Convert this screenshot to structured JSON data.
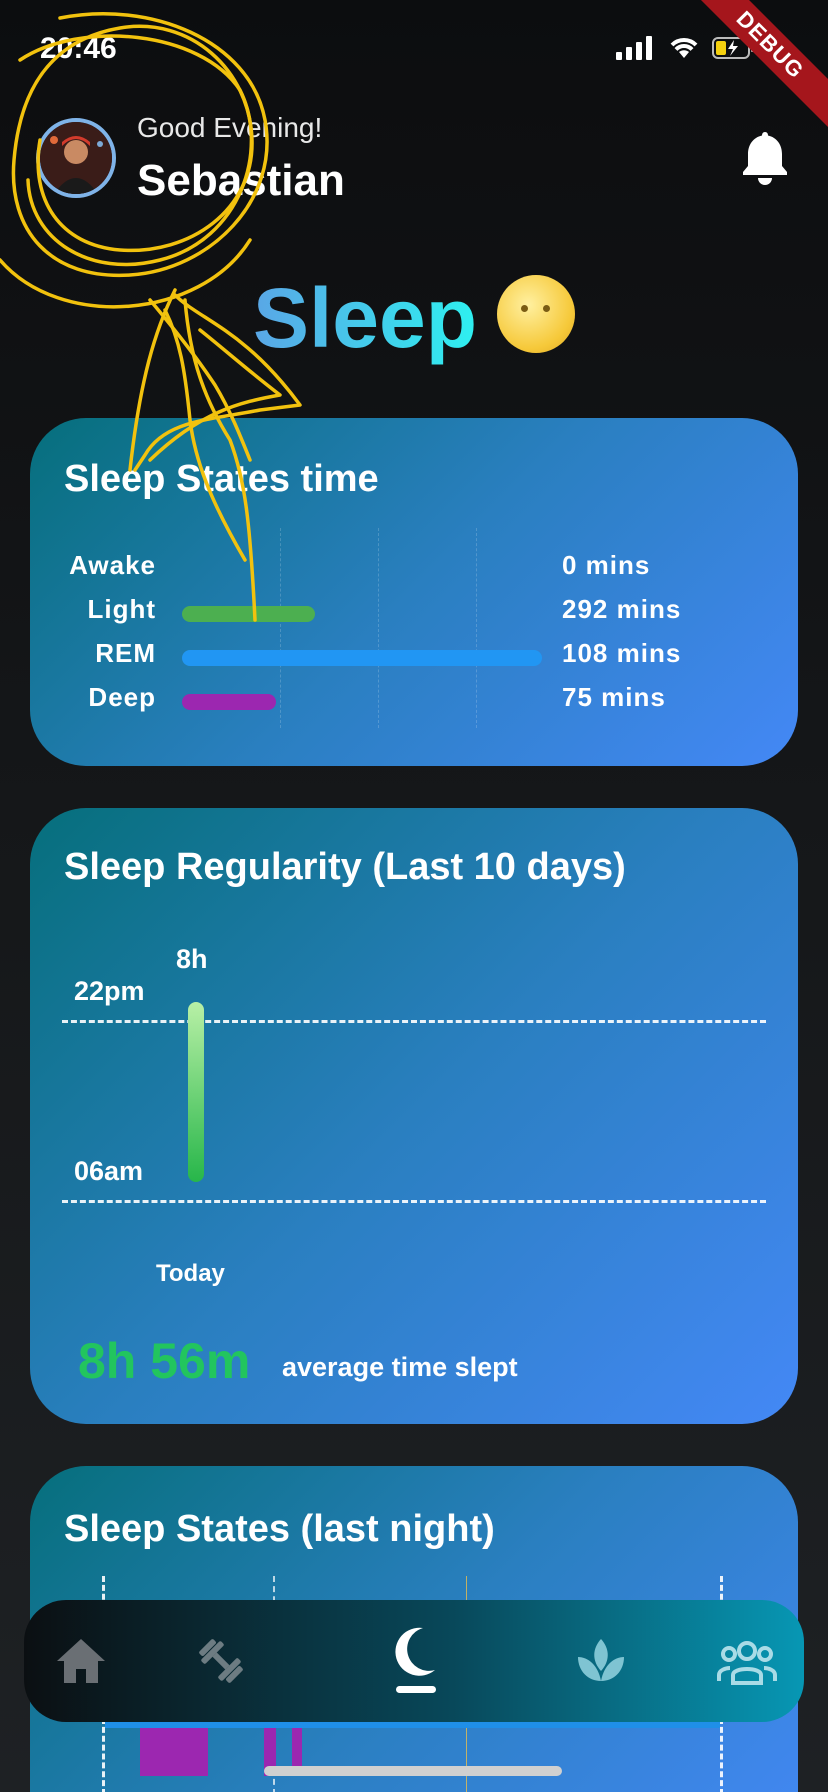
{
  "status_bar": {
    "time": "20:46",
    "debug_label": "DEBUG"
  },
  "header": {
    "greeting": "Good Evening!",
    "user_name": "Sebastian"
  },
  "page": {
    "title": "Sleep"
  },
  "sleep_states_time": {
    "title": "Sleep States time",
    "rows": [
      {
        "label": "Awake",
        "value": "0 mins",
        "bar_fraction": 0.0,
        "color": "#4caf50"
      },
      {
        "label": "Light",
        "value": "292 mins",
        "bar_fraction": 0.37,
        "color": "#4caf50"
      },
      {
        "label": "REM",
        "value": "108 mins",
        "bar_fraction": 1.0,
        "color": "#2196f3"
      },
      {
        "label": "Deep",
        "value": "75 mins",
        "bar_fraction": 0.26,
        "color": "#9c27b0"
      }
    ]
  },
  "sleep_regularity": {
    "title": "Sleep Regularity (Last 10 days)",
    "bar_label": "8h",
    "top_time": "22pm",
    "bottom_time": "06am",
    "day_label": "Today",
    "average_value": "8h 56m",
    "average_caption": "average time slept",
    "accent_color": "#22c55e"
  },
  "sleep_states_last_night": {
    "title": "Sleep States (last night)"
  },
  "bottom_nav": {
    "items": [
      {
        "icon": "home-icon",
        "active": false
      },
      {
        "icon": "dumbbell-icon",
        "active": false
      },
      {
        "icon": "moon-icon",
        "active": true
      },
      {
        "icon": "lotus-icon",
        "active": false
      },
      {
        "icon": "group-icon",
        "active": false
      }
    ]
  }
}
